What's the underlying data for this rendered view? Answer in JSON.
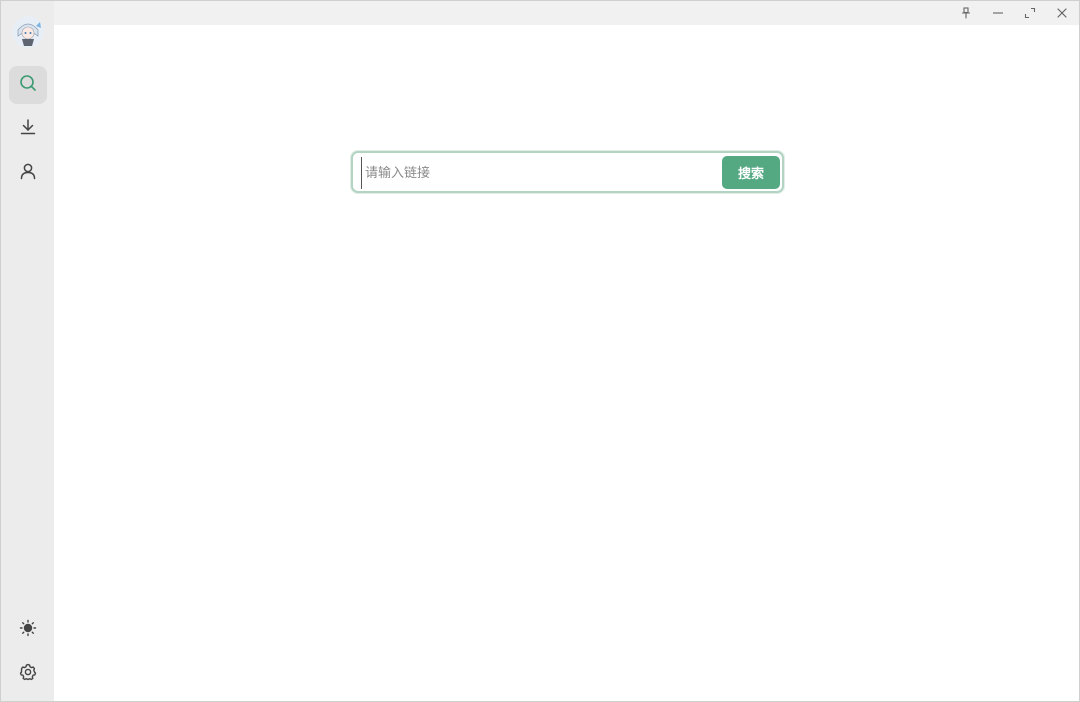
{
  "sidebar": {
    "avatar": "avatar",
    "nav": [
      {
        "name": "search",
        "icon": "search-icon"
      },
      {
        "name": "download",
        "icon": "download-icon"
      },
      {
        "name": "user",
        "icon": "user-icon"
      }
    ],
    "bottom": [
      {
        "name": "theme",
        "icon": "sun-icon"
      },
      {
        "name": "settings",
        "icon": "gear-icon"
      }
    ]
  },
  "titlebar": {
    "controls": [
      "pin-icon",
      "minimize-icon",
      "maximize-icon",
      "close-icon"
    ]
  },
  "search": {
    "placeholder": "请输入链接",
    "button_label": "搜索"
  },
  "colors": {
    "accent": "#54a983",
    "focus_border": "#b3d4c3",
    "sidebar_bg": "#ececec",
    "active_bg": "#dcdcdc"
  }
}
